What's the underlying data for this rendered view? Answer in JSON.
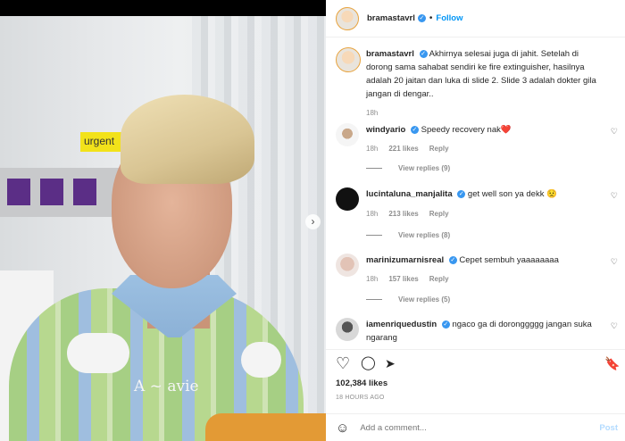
{
  "post": {
    "author": "bramastavrl",
    "follow_label": "Follow",
    "dot": "•",
    "caption_user": "bramastavrl",
    "caption_text": "Akhirnya selesai juga di jahit. Setelah di dorong sama sahabat sendiri ke fire extinguisher, hasilnya adalah 20 jaitan dan luka di slide 2. Slide 3 adalah dokter gila jangan di dengar..",
    "caption_time": "18h",
    "likes": "102,384 likes",
    "timestamp": "18 HOURS AGO"
  },
  "photo": {
    "urgent_label": "urgent",
    "shirt_print": "A  ~ avie",
    "next_icon": "›"
  },
  "comments": [
    {
      "user": "windyario",
      "text": "Speedy recovery nak",
      "emoji": "❤️",
      "time": "18h",
      "likes": "221 likes",
      "reply": "Reply",
      "view_replies": "View replies (9)"
    },
    {
      "user": "lucintaluna_manjalita",
      "text": "get well son ya dekk",
      "emoji": "😟",
      "time": "18h",
      "likes": "213 likes",
      "reply": "Reply",
      "view_replies": "View replies (8)"
    },
    {
      "user": "marinizumarnisreal",
      "text": "Cepet sembuh yaaaaaaaa",
      "emoji": "",
      "time": "18h",
      "likes": "157 likes",
      "reply": "Reply",
      "view_replies": "View replies (5)"
    },
    {
      "user": "iamenriquedustin",
      "text": "ngaco ga di doronggggg jangan suka ngarang",
      "emoji": "",
      "time": "",
      "likes": "",
      "reply": "",
      "view_replies": ""
    }
  ],
  "actions": {
    "like_icon": "♡",
    "comment_icon": "◯",
    "share_icon": "➤",
    "save_icon": "🔖"
  },
  "add_comment": {
    "emoji_icon": "☺",
    "placeholder": "Add a comment...",
    "post_label": "Post"
  },
  "verified_icon": "✓",
  "heart_small": "♡"
}
